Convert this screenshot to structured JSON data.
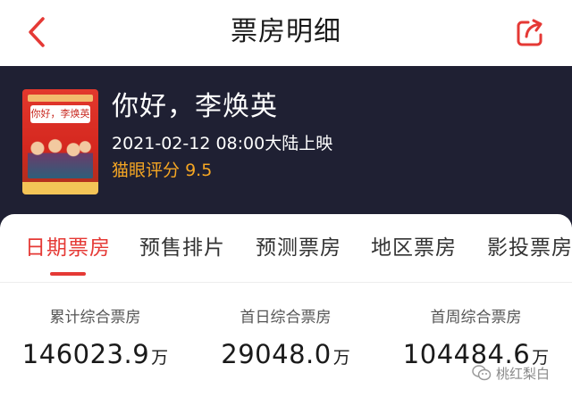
{
  "header": {
    "title": "票房明细",
    "back_icon": "chevron-left-icon",
    "share_icon": "share-icon",
    "accent_color": "#e53935"
  },
  "movie": {
    "poster_title": "你好，李焕英",
    "title": "你好，李焕英",
    "release": "2021-02-12 08:00大陆上映",
    "rating_label": "猫眼评分",
    "rating_value": "9.5",
    "rating_color": "#f5a623",
    "header_bg": "#1f2033"
  },
  "tabs": [
    {
      "label": "日期票房",
      "active": true
    },
    {
      "label": "预售排片",
      "active": false
    },
    {
      "label": "预测票房",
      "active": false
    },
    {
      "label": "地区票房",
      "active": false
    },
    {
      "label": "影投票房",
      "active": false
    }
  ],
  "stats": [
    {
      "label": "累计综合票房",
      "value": "146023.9",
      "unit": "万"
    },
    {
      "label": "首日综合票房",
      "value": "29048.0",
      "unit": "万"
    },
    {
      "label": "首周综合票房",
      "value": "104484.6",
      "unit": "万"
    }
  ],
  "watermark": {
    "text": "桃红梨白",
    "icon": "wechat-official-icon"
  }
}
